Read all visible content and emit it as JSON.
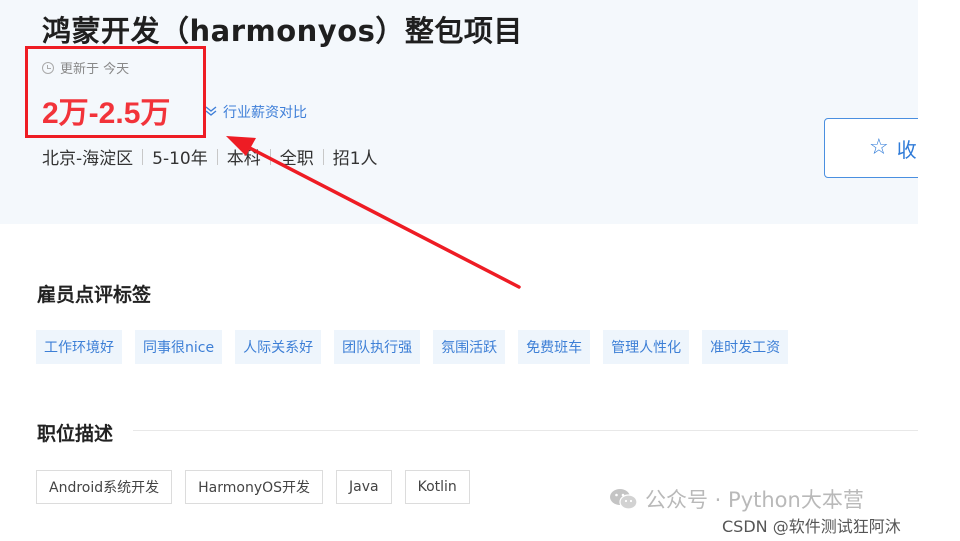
{
  "job": {
    "title": "鸿蒙开发（harmonyos）整包项目",
    "updated": "更新于 今天",
    "salary": "2万-2.5万",
    "salary_compare": "行业薪资对比",
    "meta": [
      "北京-海淀区",
      "5-10年",
      "本科",
      "全职",
      "招1人"
    ],
    "collect_label": "收"
  },
  "reviews": {
    "heading": "雇员点评标签",
    "tags": [
      "工作环境好",
      "同事很nice",
      "人际关系好",
      "团队执行强",
      "氛围活跃",
      "免费班车",
      "管理人性化",
      "准时发工资"
    ]
  },
  "description": {
    "heading": "职位描述",
    "skills": [
      "Android系统开发",
      "HarmonyOS开发",
      "Java",
      "Kotlin"
    ]
  },
  "watermark": {
    "wechat": "公众号 · Python大本营",
    "csdn": "CSDN @软件测试狂阿沐"
  },
  "annotation": {
    "color": "#ee1c24"
  },
  "icons": {
    "clock": "clock-icon",
    "compare": "salary-compare-icon",
    "star": "star-icon",
    "wechat": "wechat-icon"
  }
}
